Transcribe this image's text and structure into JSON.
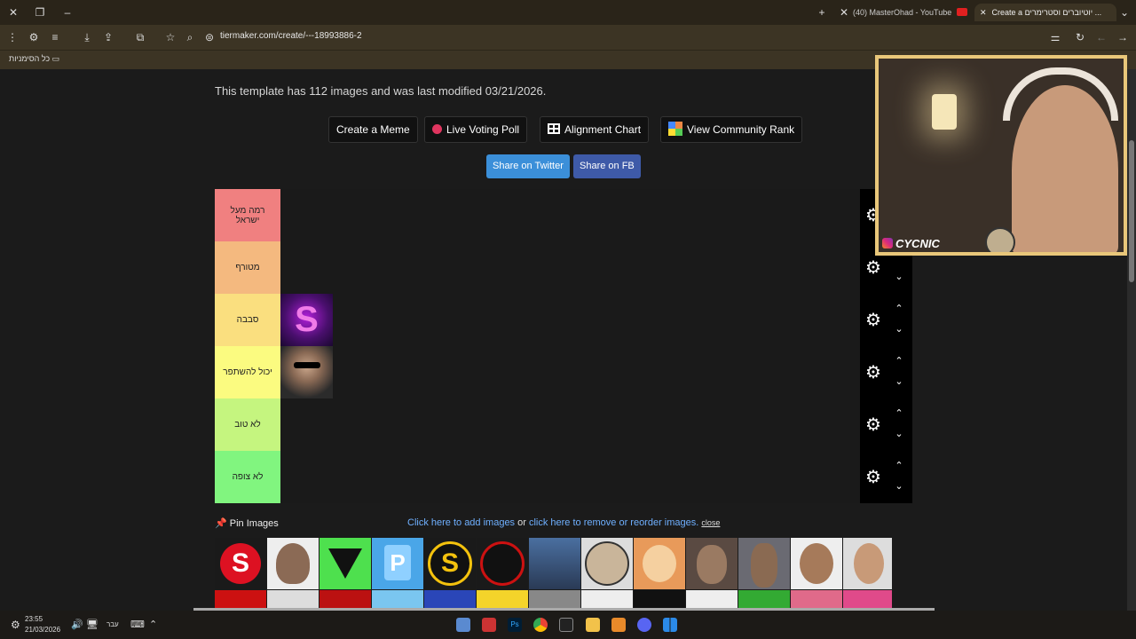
{
  "browser": {
    "tabs": [
      {
        "label": "(40) MasterOhad - YouTube",
        "active": false
      },
      {
        "label": "Create a יוטיוברים וסטרימרים ...",
        "active": true
      }
    ],
    "url": "tiermaker.com/create/---18993886-2",
    "bookmarks_label": "כל הסימניות"
  },
  "page": {
    "info": "This template has 112 images and was last modified 03/21/2026.",
    "buttons": {
      "meme": "Create a Meme",
      "poll": "Live Voting Poll",
      "alignment": "Alignment Chart",
      "community": "View Community Rank"
    },
    "share": {
      "twitter": "Share on Twitter",
      "fb": "Share on FB"
    },
    "tiers": [
      {
        "label": "רמה מעל ישראל",
        "color": "#f08080"
      },
      {
        "label": "מטורף",
        "color": "#f4b97f"
      },
      {
        "label": "סבבה",
        "color": "#fadf7f"
      },
      {
        "label": "יכול להשתפר",
        "color": "#fbfb80"
      },
      {
        "label": "לא טוב",
        "color": "#c5f57f"
      },
      {
        "label": "לא צופה",
        "color": "#81f57f"
      }
    ],
    "pin_images": "Pin Images",
    "add_link": "Click here to add images",
    "or_text": "or",
    "remove_link": "click here to remove or reorder images.",
    "close_link": "close"
  },
  "overlay": {
    "streamer_tag": "CYCNIC"
  },
  "taskbar": {
    "time": "23:55",
    "date": "21/03/2026",
    "lang": "עבר"
  }
}
